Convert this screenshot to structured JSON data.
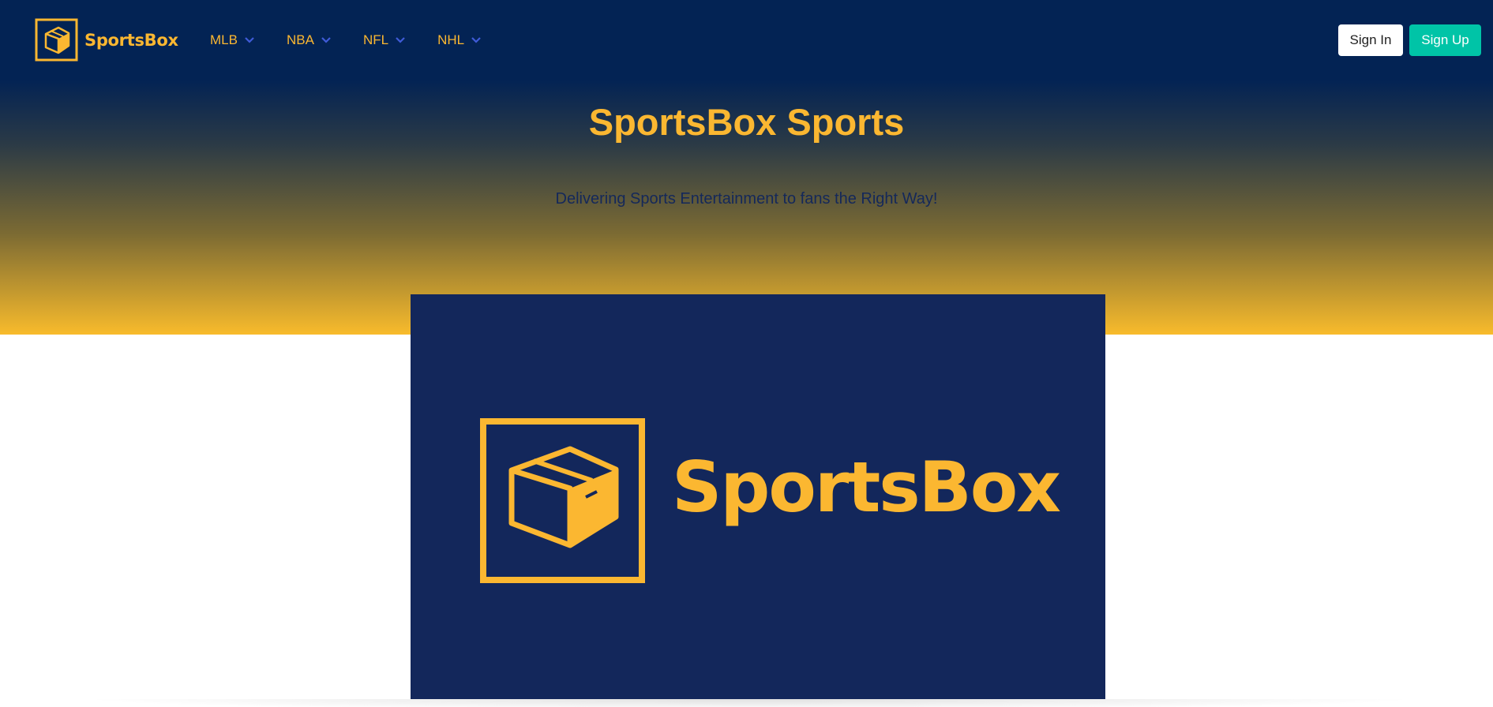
{
  "brand": {
    "name": "SportsBox",
    "icon": "box-icon"
  },
  "nav": {
    "items": [
      {
        "label": "MLB",
        "icon": "chevron-down-icon"
      },
      {
        "label": "NBA",
        "icon": "chevron-down-icon"
      },
      {
        "label": "NFL",
        "icon": "chevron-down-icon"
      },
      {
        "label": "NHL",
        "icon": "chevron-down-icon"
      }
    ]
  },
  "auth": {
    "sign_in_label": "Sign In",
    "sign_up_label": "Sign Up"
  },
  "hero": {
    "title": "SportsBox Sports",
    "subtitle": "Delivering Sports Entertainment to fans the Right Way!"
  },
  "logo_image": {
    "wordmark": "SportsBox",
    "icon": "box-icon"
  },
  "colors": {
    "navbar_bg": "#032354",
    "accent_gold": "#fbb731",
    "sign_up_teal": "#00c4a7",
    "logo_card_bg": "#13275b",
    "chevron_blue": "#3f5bd8"
  }
}
